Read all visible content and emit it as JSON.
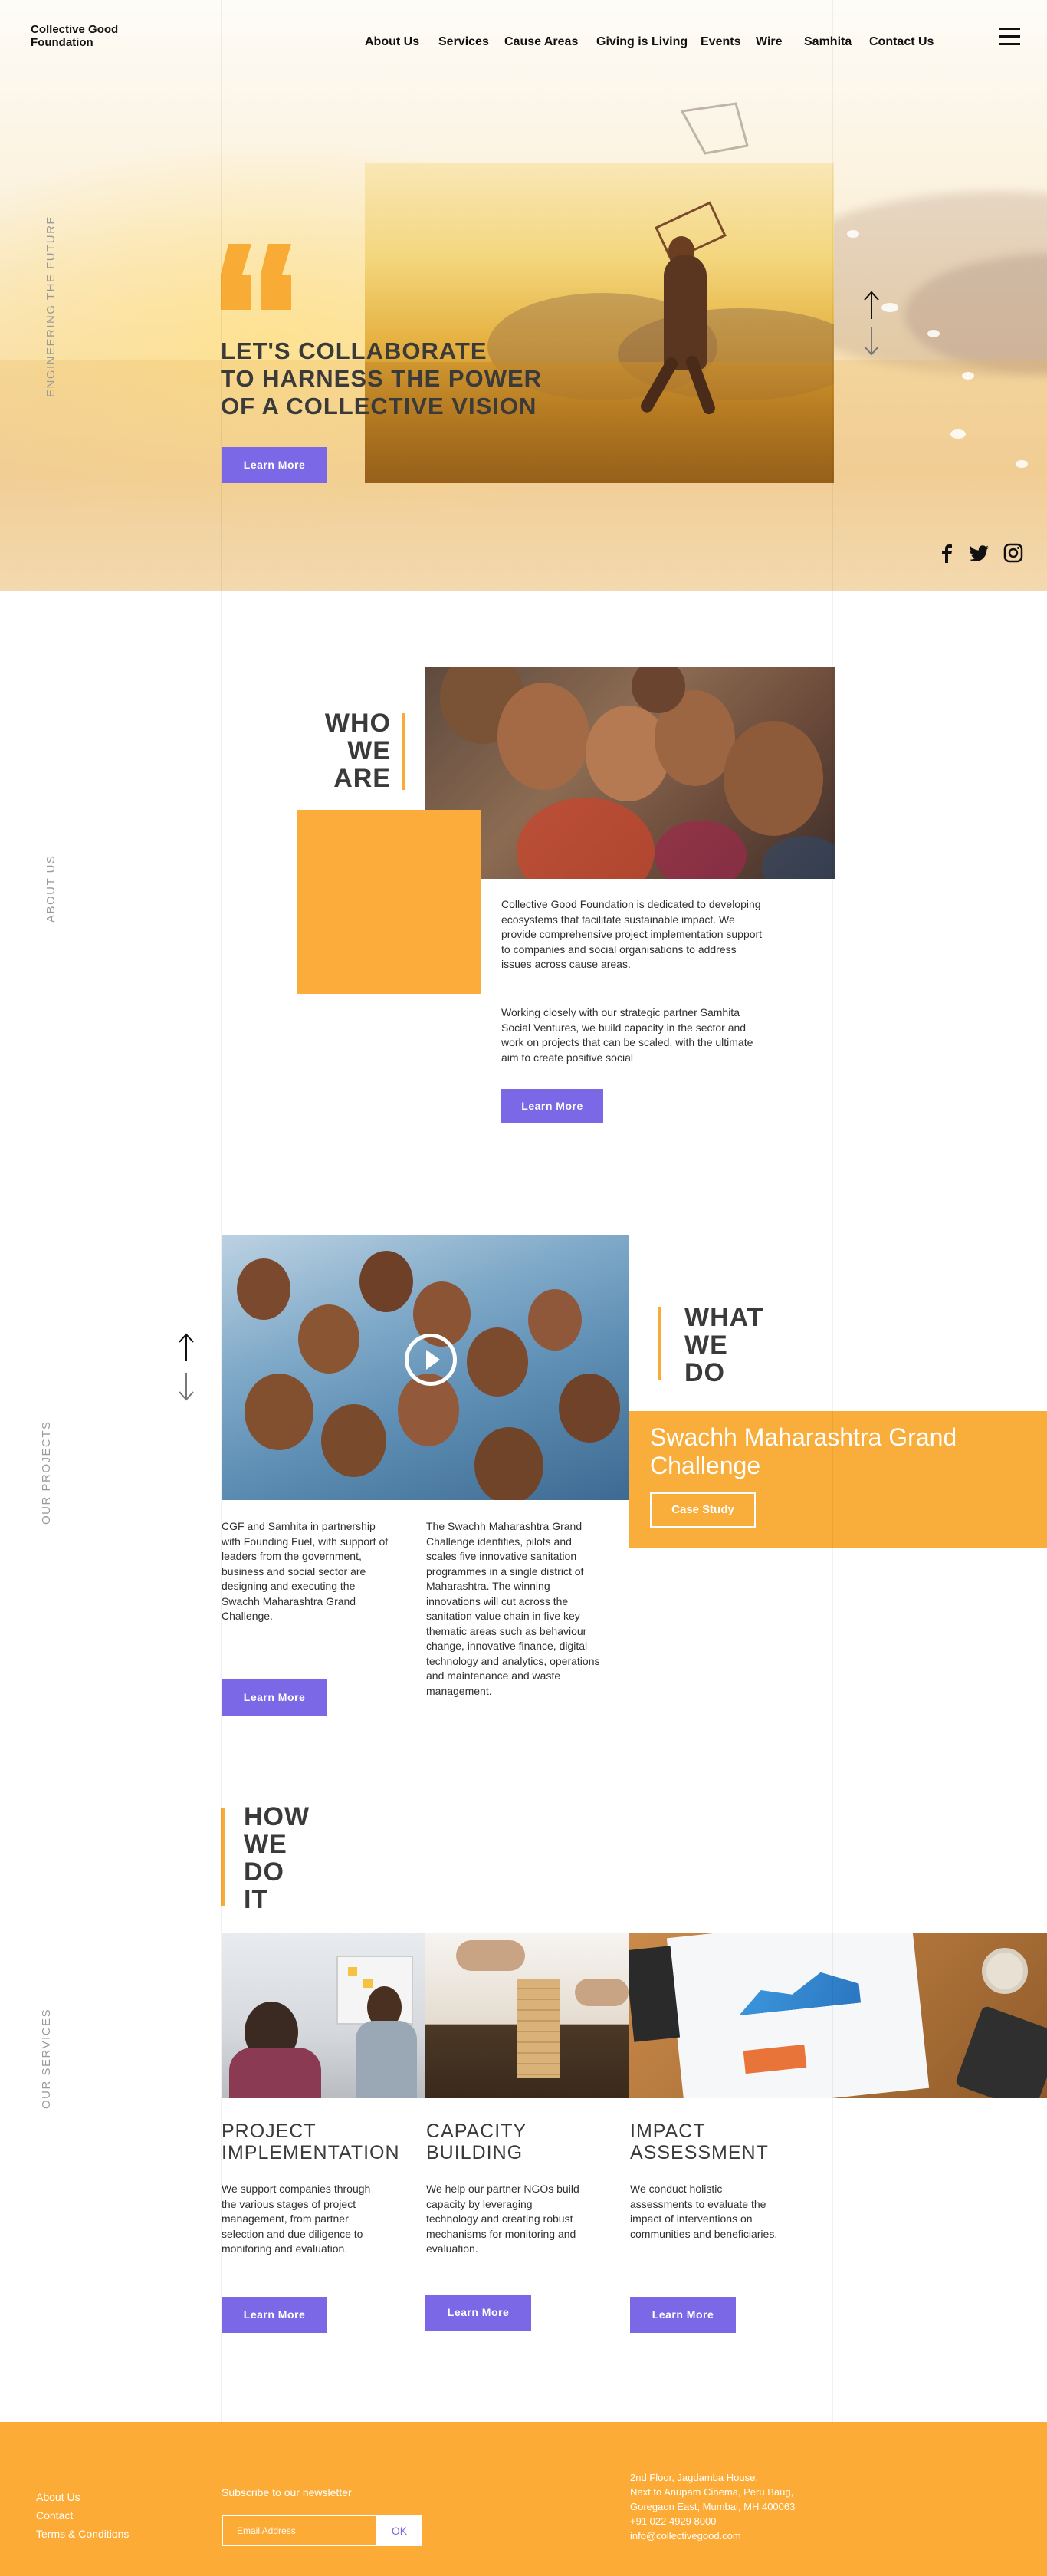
{
  "brand": {
    "name": "Collective Good Foundation"
  },
  "nav": {
    "items": [
      "About Us",
      "Services",
      "Cause Areas",
      "Giving is Living",
      "Events",
      "Wire",
      "Samhita",
      "Contact Us"
    ]
  },
  "hero": {
    "side_label": "ENGINEERING THE FUTURE",
    "heading": [
      "LET'S COLLABORATE",
      "TO HARNESS THE POWER",
      "OF A COLLECTIVE VISION"
    ],
    "button": "Learn More",
    "social": [
      "facebook-icon",
      "twitter-icon",
      "instagram-icon"
    ]
  },
  "about": {
    "side_label": "ABOUT US",
    "title": [
      "WHO",
      "WE",
      "ARE"
    ],
    "para1": "Collective Good Foundation is dedicated to developing ecosystems that facilitate sustainable impact. We provide comprehensive project implementation support to companies and social organisations to address issues across cause areas.",
    "para2": "Working closely with our strategic partner Samhita Social Ventures, we build capacity in the sector and work on projects that can be scaled, with the ultimate aim to create positive social",
    "button": "Learn More"
  },
  "projects": {
    "side_label": "OUR PROJECTS",
    "title": [
      "WHAT",
      "WE",
      "DO"
    ],
    "case_title": "Swachh Maharashtra Grand Challenge",
    "case_button": "Case Study",
    "left_text": "CGF and Samhita in partnership with Founding Fuel, with support of leaders from the government, business and social sector are designing and executing the Swachh Maharashtra Grand Challenge.",
    "right_text": "The Swachh Maharashtra Grand Challenge identifies, pilots and scales five innovative sanitation programmes in a single district of Maharashtra. The winning innovations will cut across the sanitation value chain in five key thematic areas such as behaviour change, innovative finance, digital technology and analytics, operations and maintenance and waste management.",
    "button": "Learn More"
  },
  "services": {
    "side_label": "OUR SERVICES",
    "title": [
      "HOW",
      "WE",
      "DO",
      "IT"
    ],
    "items": [
      {
        "title": [
          "PROJECT",
          "IMPLEMENTATION"
        ],
        "text": "We support companies through the various stages of project management, from partner selection and due diligence to monitoring and evaluation.",
        "button": "Learn More"
      },
      {
        "title": [
          "CAPACITY",
          "BUILDING"
        ],
        "text": "We help our partner NGOs build capacity by leveraging technology and creating robust mechanisms for monitoring and evaluation.",
        "button": "Learn More"
      },
      {
        "title": [
          "IMPACT",
          "ASSESSMENT"
        ],
        "text": "We conduct holistic assessments to evaluate the impact of interventions on communities and beneficiaries.",
        "button": "Learn More"
      }
    ]
  },
  "footer": {
    "links": [
      "About Us",
      "Contact",
      "Terms & Conditions"
    ],
    "newsletter_label": "Subscribe to our newsletter",
    "email_placeholder": "Email Address",
    "ok_label": "OK",
    "address": [
      "2nd Floor, Jagdamba House,",
      "Next to Anupam Cinema, Peru Baug,",
      "Goregaon East, Mumbai, MH 400063",
      "+91 022 4929 8000",
      "info@collectivegood.com"
    ]
  },
  "colors": {
    "accent": "#f8ac35",
    "button": "#7a68e6",
    "footer": "#fcac36"
  }
}
